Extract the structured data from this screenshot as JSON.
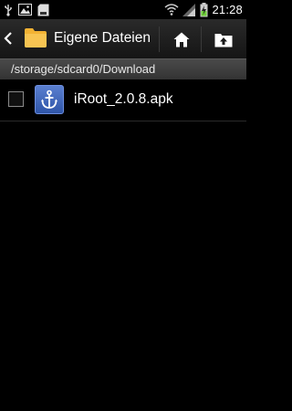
{
  "status_bar": {
    "time": "21:28",
    "left_icons": [
      "usb-icon",
      "gallery-icon",
      "storage-card-icon"
    ],
    "right_icons": [
      "wifi-icon",
      "signal-icon",
      "battery-charging-icon"
    ]
  },
  "action_bar": {
    "title": "Eigene Dateien",
    "icons": [
      "back-chevron-icon",
      "folder-icon",
      "home-icon",
      "folder-up-icon"
    ]
  },
  "path_bar": {
    "path": "/storage/sdcard0/Download"
  },
  "files": [
    {
      "name": "iRoot_2.0.8.apk",
      "icon": "anchor-icon",
      "checked": false
    }
  ],
  "colors": {
    "background": "#000000",
    "folder_yellow": "#f2b233",
    "apk_icon_blue": "#3f66bf"
  }
}
